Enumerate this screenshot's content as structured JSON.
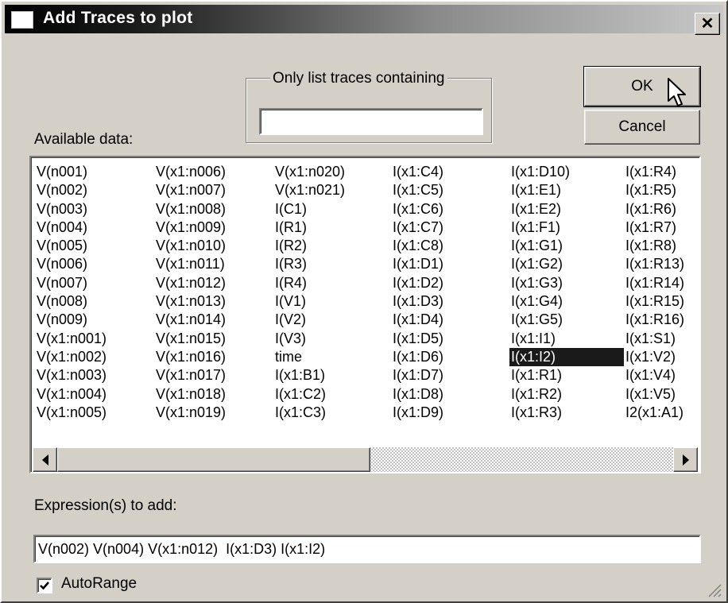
{
  "window": {
    "title": "Add Traces to plot",
    "close_symbol": "✕"
  },
  "filter": {
    "group_label": "Only list traces containing",
    "value": ""
  },
  "available_label": "Available data:",
  "buttons": {
    "ok_label": "OK",
    "cancel_label": "Cancel"
  },
  "traces": {
    "columns": [
      [
        "V(n001)",
        "V(n002)",
        "V(n003)",
        "V(n004)",
        "V(n005)",
        "V(n006)",
        "V(n007)",
        "V(n008)",
        "V(n009)",
        "V(x1:n001)",
        "V(x1:n002)",
        "V(x1:n003)",
        "V(x1:n004)",
        "V(x1:n005)"
      ],
      [
        "V(x1:n006)",
        "V(x1:n007)",
        "V(x1:n008)",
        "V(x1:n009)",
        "V(x1:n010)",
        "V(x1:n011)",
        "V(x1:n012)",
        "V(x1:n013)",
        "V(x1:n014)",
        "V(x1:n015)",
        "V(x1:n016)",
        "V(x1:n017)",
        "V(x1:n018)",
        "V(x1:n019)"
      ],
      [
        "V(x1:n020)",
        "V(x1:n021)",
        "I(C1)",
        "I(R1)",
        "I(R2)",
        "I(R3)",
        "I(R4)",
        "I(V1)",
        "I(V2)",
        "I(V3)",
        "time",
        "I(x1:B1)",
        "I(x1:C2)",
        "I(x1:C3)"
      ],
      [
        "I(x1:C4)",
        "I(x1:C5)",
        "I(x1:C6)",
        "I(x1:C7)",
        "I(x1:C8)",
        "I(x1:D1)",
        "I(x1:D2)",
        "I(x1:D3)",
        "I(x1:D4)",
        "I(x1:D5)",
        "I(x1:D6)",
        "I(x1:D7)",
        "I(x1:D8)",
        "I(x1:D9)"
      ],
      [
        "I(x1:D10)",
        "I(x1:E1)",
        "I(x1:E2)",
        "I(x1:F1)",
        "I(x1:G1)",
        "I(x1:G2)",
        "I(x1:G3)",
        "I(x1:G4)",
        "I(x1:G5)",
        "I(x1:I1)",
        "I(x1:I2)",
        "I(x1:R1)",
        "I(x1:R2)",
        "I(x1:R3)"
      ],
      [
        "I(x1:R4)",
        "I(x1:R5)",
        "I(x1:R6)",
        "I(x1:R7)",
        "I(x1:R8)",
        "I(x1:R13)",
        "I(x1:R14)",
        "I(x1:R15)",
        "I(x1:R16)",
        "I(x1:S1)",
        "I(x1:V2)",
        "I(x1:V4)",
        "I(x1:V5)",
        "I2(x1:A1)"
      ]
    ],
    "selected": "I(x1:I2)"
  },
  "scrollbar": {
    "left_arrow_icon": "scroll-left-arrow",
    "right_arrow_icon": "scroll-right-arrow"
  },
  "expression": {
    "label": "Expression(s) to add:",
    "value": "V(n002) V(n004) V(x1:n012)  I(x1:D3) I(x1:I2)"
  },
  "autorange": {
    "label": "AutoRange",
    "checked": true
  },
  "colors": {
    "face": "#d4d0c8",
    "selection": "#1a1a1a",
    "title_start": "#000000"
  }
}
